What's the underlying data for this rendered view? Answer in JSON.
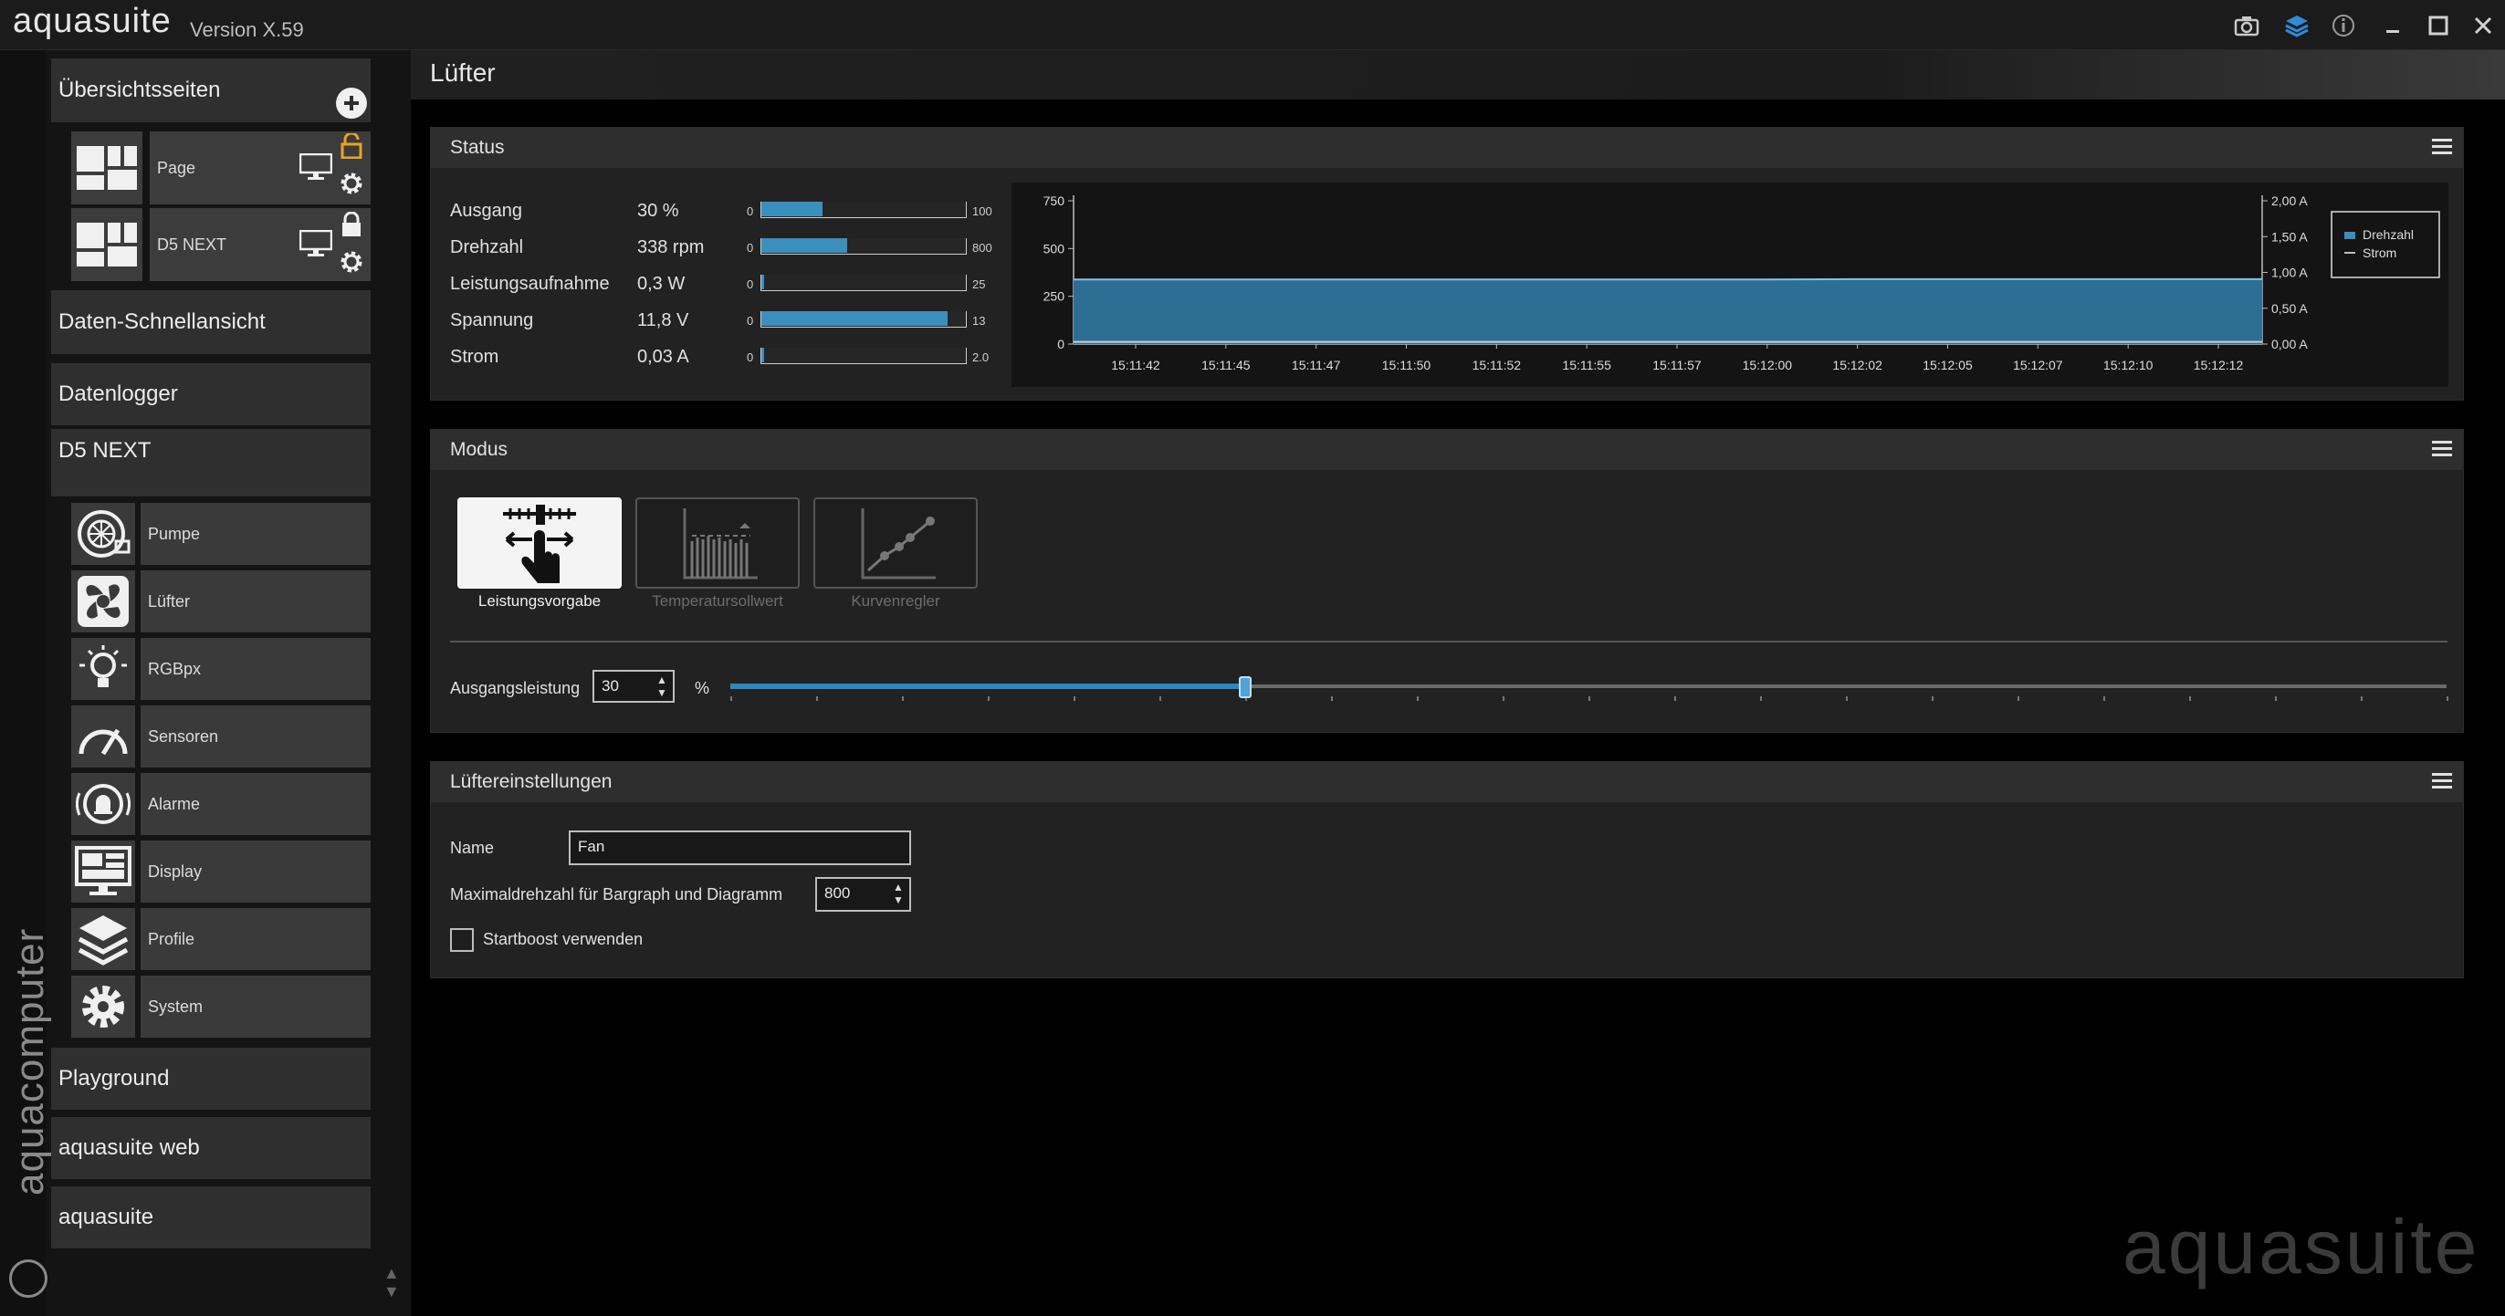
{
  "app": {
    "name": "aquasuite",
    "version": "Version X.59",
    "brand_vertical": "aquacomputer",
    "watermark": "aquasuite"
  },
  "titlebar_icons": [
    "camera-icon",
    "layers-icon",
    "info-icon",
    "minimize-icon",
    "maximize-icon",
    "close-icon"
  ],
  "sidebar": {
    "overview_label": "Übersichtsseiten",
    "pages": [
      {
        "label": "Page",
        "locked": false
      },
      {
        "label": "D5 NEXT",
        "locked": true
      }
    ],
    "quickview_label": "Daten-Schnellansicht",
    "logger_label": "Datenlogger",
    "device_label": "D5 NEXT",
    "device_items": [
      {
        "label": "Pumpe",
        "icon": "pump-icon"
      },
      {
        "label": "Lüfter",
        "icon": "fan-icon"
      },
      {
        "label": "RGBpx",
        "icon": "lightbulb-icon"
      },
      {
        "label": "Sensoren",
        "icon": "gauge-icon"
      },
      {
        "label": "Alarme",
        "icon": "alarm-bell-icon"
      },
      {
        "label": "Display",
        "icon": "display-icon"
      },
      {
        "label": "Profile",
        "icon": "layers-icon"
      },
      {
        "label": "System",
        "icon": "gear-icon"
      }
    ],
    "playground_label": "Playground",
    "web_label": "aquasuite web",
    "suite_label": "aquasuite"
  },
  "page": {
    "title": "Lüfter"
  },
  "status": {
    "title": "Status",
    "rows": [
      {
        "label": "Ausgang",
        "value": "30 %",
        "min": "0",
        "max": "100",
        "fraction": 0.3
      },
      {
        "label": "Drehzahl",
        "value": "338 rpm",
        "min": "0",
        "max": "800",
        "fraction": 0.42
      },
      {
        "label": "Leistungsaufnahme",
        "value": "0,3 W",
        "min": "0",
        "max": "25",
        "fraction": 0.012
      },
      {
        "label": "Spannung",
        "value": "11,8 V",
        "min": "0",
        "max": "13",
        "fraction": 0.91
      },
      {
        "label": "Strom",
        "value": "0,03 A",
        "min": "0",
        "max": "2.0",
        "fraction": 0.015
      }
    ]
  },
  "chart_data": {
    "type": "area",
    "x": [
      "15:11:42",
      "15:11:45",
      "15:11:47",
      "15:11:50",
      "15:11:52",
      "15:11:55",
      "15:11:57",
      "15:12:00",
      "15:12:02",
      "15:12:05",
      "15:12:07",
      "15:12:10",
      "15:12:12"
    ],
    "series": [
      {
        "name": "Drehzahl",
        "axis": "left",
        "values": [
          338,
          338,
          338,
          338,
          338,
          338,
          338,
          338,
          340,
          340,
          340,
          340,
          340
        ],
        "color": "#3a8fbd"
      },
      {
        "name": "Strom",
        "axis": "right",
        "values": [
          0.03,
          0.03,
          0.03,
          0.03,
          0.03,
          0.03,
          0.03,
          0.03,
          0.03,
          0.03,
          0.03,
          0.03,
          0.03
        ],
        "color": "#bdbdbd"
      }
    ],
    "yticks_left": [
      "0",
      "250",
      "500",
      "750"
    ],
    "ylim_left": [
      0,
      750
    ],
    "yticks_right": [
      "0,00 A",
      "0,50 A",
      "1,00 A",
      "1,50 A",
      "2,00 A"
    ],
    "ylim_right": [
      0,
      2
    ],
    "legend": [
      "Drehzahl",
      "Strom"
    ],
    "legend_position": "top-right",
    "grid": false
  },
  "modus": {
    "title": "Modus",
    "modes": [
      {
        "label": "Leistungsvorgabe",
        "active": true
      },
      {
        "label": "Temperatursollwert",
        "active": false
      },
      {
        "label": "Kurvenregler",
        "active": false
      }
    ],
    "output_label": "Ausgangsleistung",
    "output_value": "30",
    "output_unit": "%",
    "output_fraction": 0.3
  },
  "fan_settings": {
    "title": "Lüftereinstellungen",
    "name_label": "Name",
    "name_value": "Fan",
    "max_rpm_label": "Maximaldrehzahl für Bargraph und Diagramm",
    "max_rpm_value": "800",
    "startboost_label": "Startboost verwenden",
    "startboost_checked": false
  }
}
